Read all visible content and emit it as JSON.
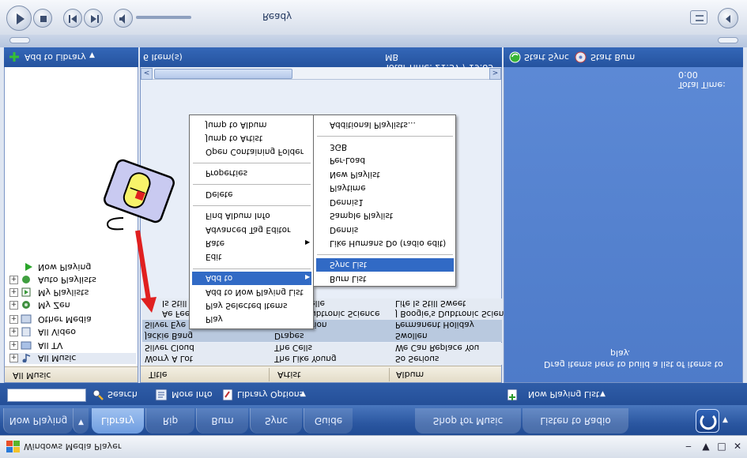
{
  "window": {
    "title": "Windows Media Player"
  },
  "status": {
    "text": "Ready"
  },
  "left_panel": {
    "add_to_library": "Add to Library",
    "items": [
      "Now Playing",
      "Auto Playlists",
      "My Playlists",
      "My Zen",
      "Other Media",
      "All Video",
      "All TV",
      "All Music"
    ],
    "selected": "All Music"
  },
  "center_panel": {
    "item_count": "6 Item(s)",
    "total_time": "Total Time: 21:37 / 19.85 MB",
    "columns": [
      "Title",
      "Artist",
      "Album"
    ],
    "rows": [
      [
        "Worry A Lot",
        "The Like Young",
        "So Serious"
      ],
      [
        "Silver Cloud",
        "The Cells",
        "We Can Replace You"
      ],
      [
        "Jackie Bang",
        "Drapes",
        "Swollen"
      ],
      [
        "Silver Eye",
        "Orion",
        "Permanent Holiday"
      ],
      [
        "Ae Feel",
        "Dubtronic Science",
        "J Boogie's Dubtronic Science"
      ],
      [
        "Is Still",
        "Belle",
        "Life Is Still Sweet"
      ]
    ]
  },
  "right_panel": {
    "start_sync": "Start Sync",
    "start_burn": "Start Burn",
    "total_time": "Total Time: 0:00",
    "drag_hint_line1": "Drag items here to build a list of items to",
    "drag_hint_line2": "play.",
    "now_playing_list": "Now Playing List"
  },
  "context_menu": {
    "items": [
      "Play",
      "Play Selected Items",
      "Add to Now Playing List",
      "Add to",
      "Edit",
      "Rate",
      "Advanced Tag Editor",
      "Find Album Info",
      "Delete",
      "Properties",
      "Open Containing Folder",
      "Jump to Artist",
      "Jump to Album"
    ],
    "highlighted": "Add to"
  },
  "submenu": {
    "items": [
      "Burn List",
      "Sync List",
      "Like Humans Do (radio edit)",
      "Dennis",
      "Sample Playlist",
      "Dennis1",
      "Playtime",
      "New Playlist",
      "Per-Load",
      "3GB",
      "Additional Playlists..."
    ],
    "highlighted": "Sync List"
  },
  "toolbar": {
    "search_label": "Search",
    "search_value": "",
    "more_info": "More Info",
    "library_options": "Library Options"
  },
  "tabs": {
    "now_playing": "Now Playing",
    "library": "Library",
    "rip": "Rip",
    "burn": "Burn",
    "sync": "Sync",
    "guide": "Guide",
    "shop": "Shop for Music",
    "radio": "Listen to Radio",
    "selected": "Library"
  },
  "colors": {
    "accent": "#316ac5",
    "band": "#2a56a0",
    "selected_row": "#b9c9df",
    "arrow": "#e02020"
  }
}
